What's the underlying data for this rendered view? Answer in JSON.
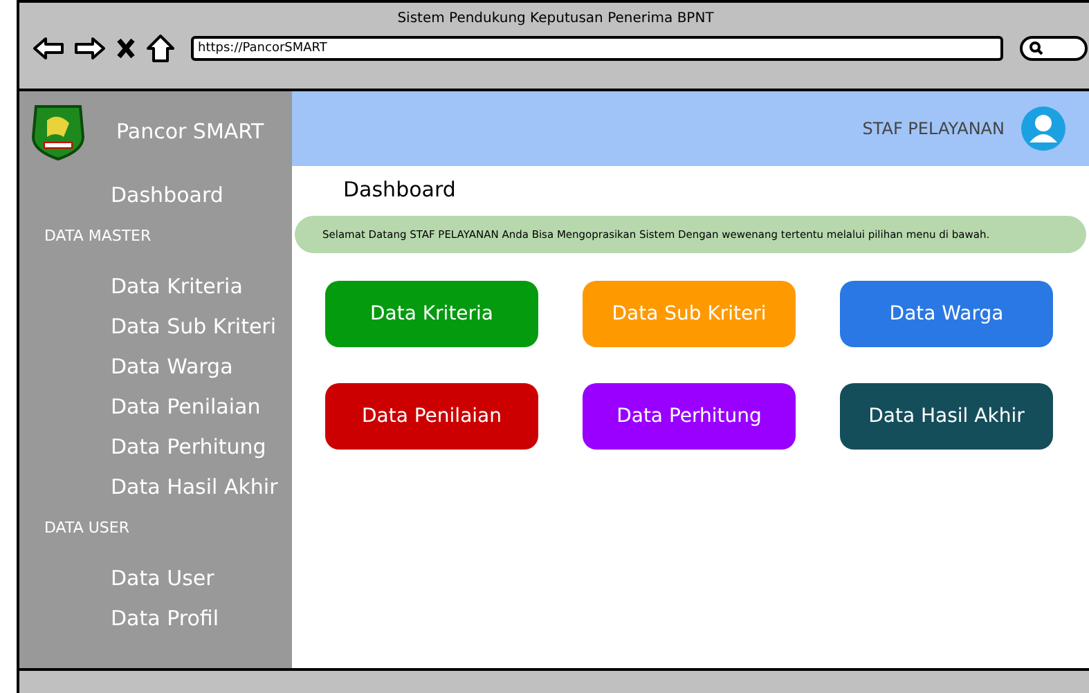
{
  "window": {
    "title": "Sistem Pendukung Keputusan Penerima BPNT",
    "url": "https://PancorSMART"
  },
  "sidebar": {
    "brand": "Pancor SMART",
    "items": [
      {
        "kind": "link",
        "label": "Dashboard"
      },
      {
        "kind": "heading",
        "label": "DATA MASTER"
      },
      {
        "kind": "link",
        "label": "Data Kriteria"
      },
      {
        "kind": "link",
        "label": "Data Sub Kriteri"
      },
      {
        "kind": "link",
        "label": "Data Warga"
      },
      {
        "kind": "link",
        "label": "Data Penilaian"
      },
      {
        "kind": "link",
        "label": "Data Perhitung"
      },
      {
        "kind": "link",
        "label": "Data Hasil Akhir"
      },
      {
        "kind": "heading",
        "label": "DATA USER"
      },
      {
        "kind": "link",
        "label": "Data User"
      },
      {
        "kind": "link",
        "label": "Data Profil"
      }
    ]
  },
  "header": {
    "user": "STAF PELAYANAN"
  },
  "page": {
    "title": "Dashboard",
    "alert": "Selamat Datang STAF PELAYANAN Anda Bisa Mengoprasikan Sistem Dengan wewenang tertentu melalui pilihan menu di bawah.",
    "tiles": [
      {
        "label": "Data Kriteria",
        "color": "#059b0f"
      },
      {
        "label": "Data Sub Kriteri",
        "color": "#ff9900"
      },
      {
        "label": "Data Warga",
        "color": "#2a78e4"
      },
      {
        "label": "Data Penilaian",
        "color": "#cc0000"
      },
      {
        "label": "Data Perhitung",
        "color": "#9900ff"
      },
      {
        "label": "Data Hasil Akhir",
        "color": "#154e5b"
      }
    ]
  }
}
